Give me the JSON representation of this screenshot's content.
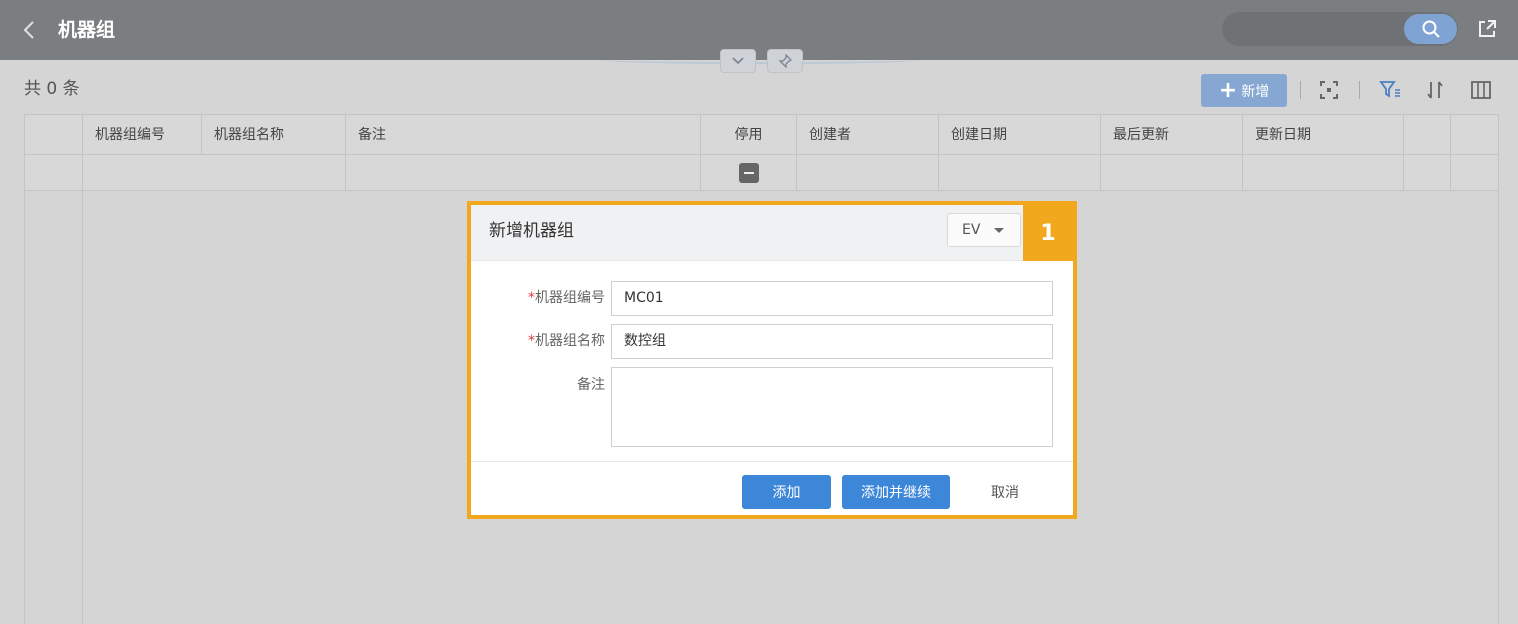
{
  "header": {
    "title": "机器组",
    "back_icon": "chevron-left-icon",
    "search_icon": "search-icon",
    "share_icon": "external-link-icon"
  },
  "toolbar": {
    "record_count": "共 0 条",
    "add_new_label": "新增",
    "icons": [
      "fullscreen-icon",
      "filter-icon",
      "sort-icon",
      "columns-icon"
    ]
  },
  "table": {
    "columns": [
      "机器组编号",
      "机器组名称",
      "备注",
      "停用",
      "创建者",
      "创建日期",
      "最后更新",
      "更新日期"
    ]
  },
  "dialog": {
    "title": "新增机器组",
    "lang_value": "EV",
    "step_badge": "1",
    "fields": [
      {
        "label": "机器组编号",
        "required_mark": "*",
        "value": "MC01"
      },
      {
        "label": "机器组名称",
        "required_mark": "*",
        "value": "数控组"
      },
      {
        "label": "备注",
        "required_mark": "",
        "value": ""
      }
    ],
    "buttons": {
      "add": "添加",
      "add_continue": "添加并继续",
      "cancel": "取消"
    }
  },
  "colors": {
    "header_bg": "#7b7e81",
    "primary": "#3d87d9",
    "highlight": "#f2a81d"
  }
}
